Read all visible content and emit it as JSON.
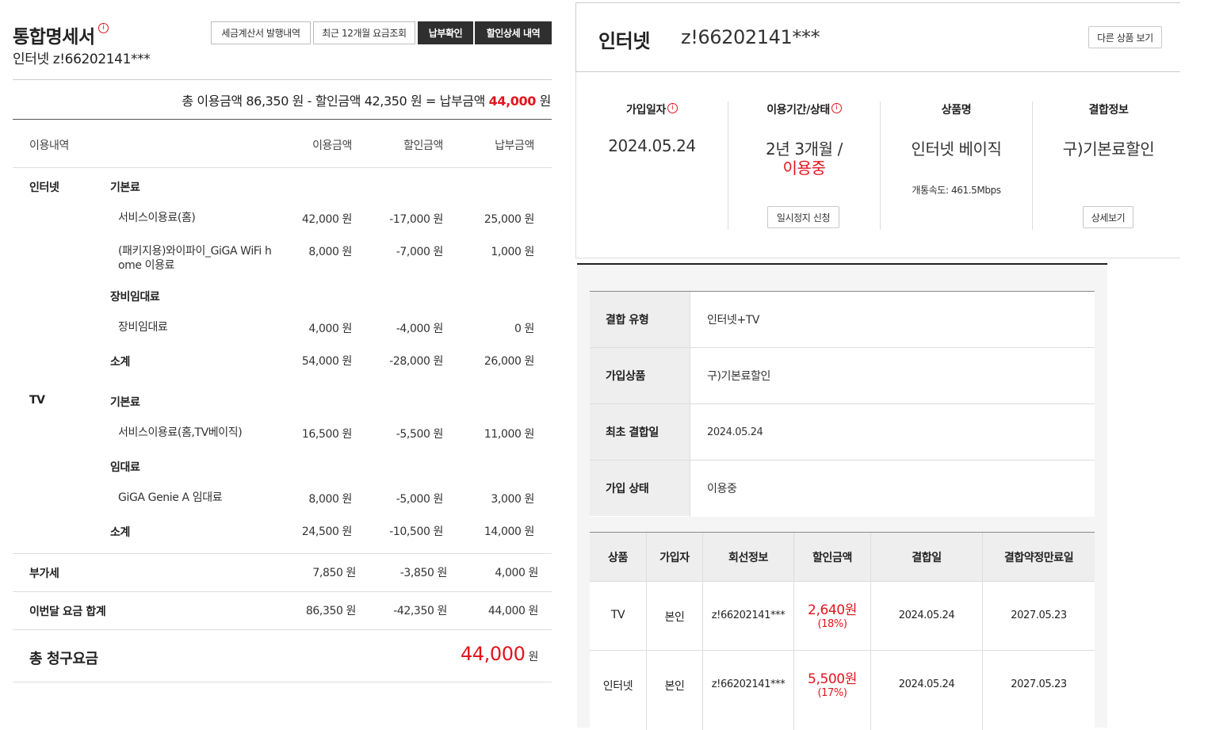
{
  "left": {
    "title": "통합명세서",
    "subtitle": "인터넷 z!66202141***",
    "buttons": [
      "세금계산서 발행내역",
      "최근 12개월 요금조회",
      "납부확인",
      "할인상세 내역"
    ],
    "summary": {
      "prefix": "총 이용금액 86,350 원 - 할인금액 42,350 원 = 납부금액 ",
      "amount": "44,000",
      "unit": " 원"
    },
    "headers": [
      "이용내역",
      "이용금액",
      "할인금액",
      "납부금액"
    ],
    "internet": {
      "label": "인터넷",
      "basic_label": "기본료",
      "service": {
        "name": "서비스이용료(홈)",
        "use": "42,000 원",
        "disc": "-17,000 원",
        "pay": "25,000 원"
      },
      "wifi": {
        "name1": "(패키지용)와이파이_GiGA WiFi h",
        "name2": "ome 이용료",
        "use": "8,000 원",
        "disc": "-7,000 원",
        "pay": "1,000 원"
      },
      "equip_label": "장비임대료",
      "equip": {
        "name": "장비임대료",
        "use": "4,000 원",
        "disc": "-4,000 원",
        "pay": "0 원"
      },
      "subtotal": {
        "name": "소계",
        "use": "54,000 원",
        "disc": "-28,000 원",
        "pay": "26,000 원"
      }
    },
    "tv": {
      "label": "TV",
      "basic_label": "기본료",
      "service": {
        "name": "서비스이용료(홈,TV베이직)",
        "use": "16,500 원",
        "disc": "-5,500 원",
        "pay": "11,000 원"
      },
      "rent_label": "임대료",
      "rent": {
        "name": "GiGA Genie A 임대료",
        "use": "8,000 원",
        "disc": "-5,000 원",
        "pay": "3,000 원"
      },
      "subtotal": {
        "name": "소계",
        "use": "24,500 원",
        "disc": "-10,500 원",
        "pay": "14,000 원"
      }
    },
    "vat": {
      "name": "부가세",
      "use": "7,850 원",
      "disc": "-3,850 원",
      "pay": "4,000 원"
    },
    "month_total": {
      "name": "이번달 요금 합계",
      "use": "86,350 원",
      "disc": "-42,350 원",
      "pay": "44,000 원"
    },
    "grand": {
      "label": "총 청구요금",
      "amount": "44,000",
      "unit": "원"
    }
  },
  "product": {
    "title": "인터넷",
    "line": "z!66202141***",
    "other_btn": "다른 상품 보기",
    "cols": [
      {
        "head": "가입일자",
        "value": "2024.05.24"
      },
      {
        "head": "이용기간/상태",
        "value1": "2년 3개월 /",
        "value2": "이용중",
        "button": "일시정지 신청"
      },
      {
        "head": "상품명",
        "value": "인터넷 베이직",
        "note": "개통속도: 461.5Mbps"
      },
      {
        "head": "결합정보",
        "value": "구)기본료할인",
        "button": "상세보기"
      }
    ]
  },
  "combo": {
    "rows": [
      {
        "label": "결합 유형",
        "value": "인터넷+TV"
      },
      {
        "label": "가입상품",
        "value": "구)기본료할인"
      },
      {
        "label": "최초 결합일",
        "value": "2024.05.24"
      },
      {
        "label": "가입 상태",
        "value": "이용중"
      }
    ],
    "table_headers": [
      "상품",
      "가입자",
      "회선정보",
      "할인금액",
      "결합일",
      "결합약정만료일"
    ],
    "table_rows": [
      {
        "product": "TV",
        "owner": "본인",
        "line": "z!66202141***",
        "disc": "2,640원",
        "pct": "(18%)",
        "date": "2024.05.24",
        "end": "2027.05.23"
      },
      {
        "product": "인터넷",
        "owner": "본인",
        "line": "z!66202141***",
        "disc": "5,500원",
        "pct": "(17%)",
        "date": "2024.05.24",
        "end": "2027.05.23"
      }
    ]
  },
  "colors": {
    "accent": "#e3141c",
    "dark_button": "#2f2f2f",
    "label_bg": "#eeeeee",
    "panel_bg": "#f5f5f5"
  }
}
